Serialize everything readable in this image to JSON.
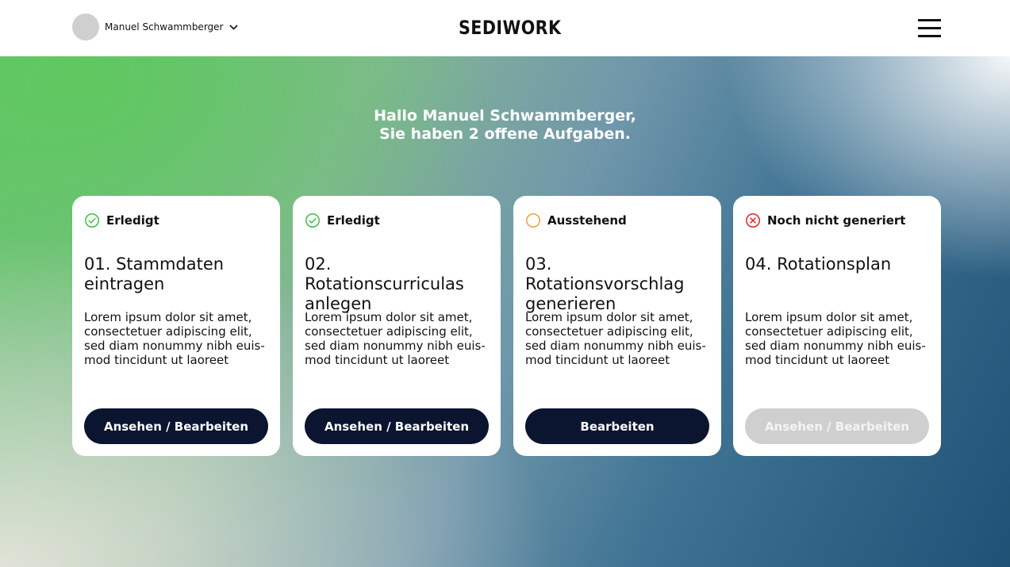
{
  "header": {
    "user_name": "Manuel Schwammberger",
    "logo_text": "SEDIWORK"
  },
  "greeting": {
    "line1": "Hallo Manuel Schwammberger,",
    "line2": "Sie haben 2 offene Aufgaben."
  },
  "cards": [
    {
      "status": "Erledigt",
      "status_icon": "check-circle-icon",
      "status_color": "#3fbf4a",
      "title": "01. Stammdaten eintragen",
      "body": "Lorem ipsum dolor sit amet, consectetuer adipiscing elit, sed diam nonummy nibh euis-mod tincidunt ut laoreet",
      "button": "Ansehen / Bearbeiten",
      "button_enabled": true
    },
    {
      "status": "Erledigt",
      "status_icon": "check-circle-icon",
      "status_color": "#3fbf4a",
      "title": "02. Rotationscurriculas anlegen",
      "body": "Lorem ipsum dolor sit amet, consectetuer adipiscing elit, sed diam nonummy nibh euis-mod tincidunt ut laoreet",
      "button": "Ansehen / Bearbeiten",
      "button_enabled": true
    },
    {
      "status": "Ausstehend",
      "status_icon": "empty-circle-icon",
      "status_color": "#f0a040",
      "title": "03. Rotationsvorschlag generieren",
      "body": "Lorem ipsum dolor sit amet, consectetuer adipiscing elit, sed diam nonummy nibh euis-mod tincidunt ut laoreet",
      "button": "Bearbeiten",
      "button_enabled": true
    },
    {
      "status": "Noch nicht generiert",
      "status_icon": "x-circle-icon",
      "status_color": "#e02424",
      "title": "04. Rotationsplan",
      "body": "Lorem ipsum dolor sit amet, consectetuer adipiscing elit, sed diam nonummy nibh euis-mod tincidunt ut laoreet",
      "button": "Ansehen / Bearbeiten",
      "button_enabled": false
    }
  ]
}
